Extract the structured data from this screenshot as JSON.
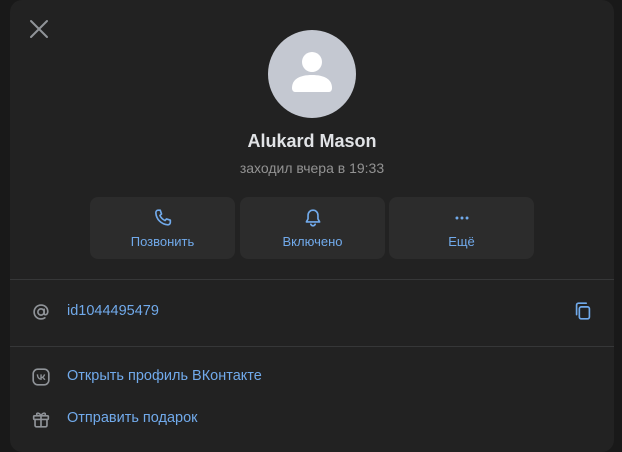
{
  "profile": {
    "name": "Alukard Mason",
    "last_seen": "заходил вчера в 19:33"
  },
  "actions": [
    {
      "label": "Позвонить",
      "icon": "phone-icon"
    },
    {
      "label": "Включено",
      "icon": "bell-icon"
    },
    {
      "label": "Ещё",
      "icon": "more-icon"
    }
  ],
  "info": {
    "user_id": "id1044495479"
  },
  "links": {
    "open_profile": "Открыть профиль ВКонтакте",
    "send_gift": "Отправить подарок"
  },
  "colors": {
    "background": "#191919",
    "panel": "#222222",
    "button": "#2c2c2c",
    "accent": "#71aaeb",
    "text_primary": "#e1e3e6",
    "text_secondary": "#939393"
  }
}
